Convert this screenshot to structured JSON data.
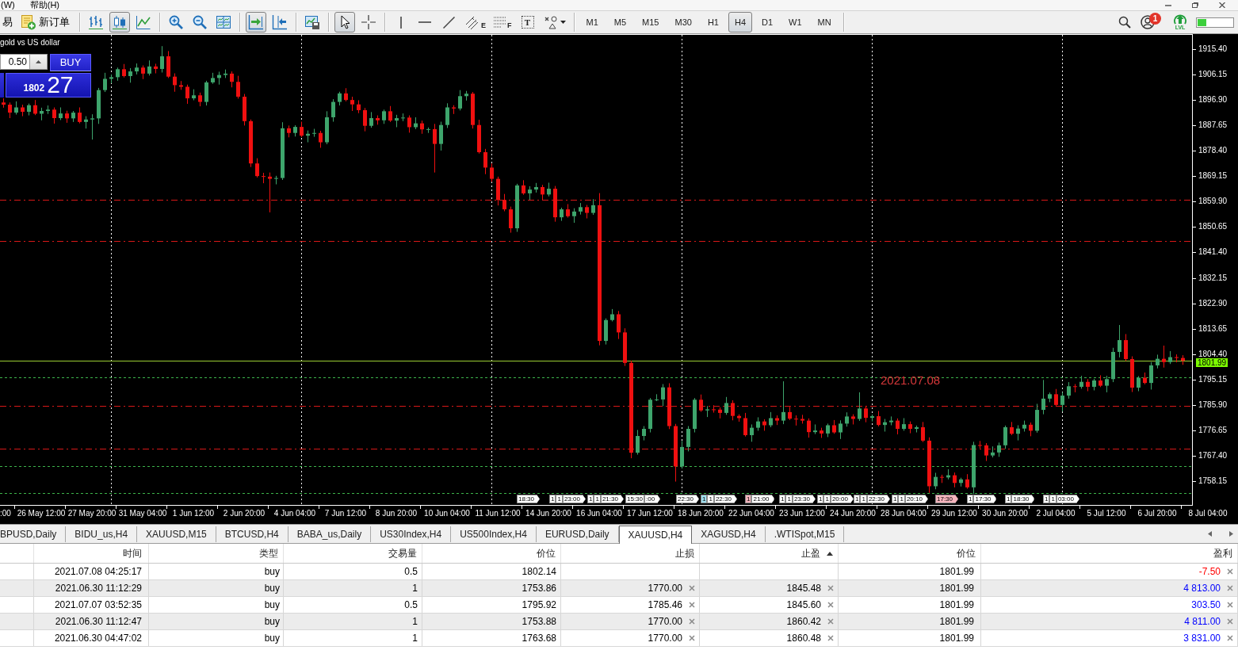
{
  "menu_bar": {
    "items": [
      {
        "label": "(W)"
      },
      {
        "label": "帮助(H)"
      }
    ]
  },
  "toolbar": {
    "trade_label": "易",
    "new_order_label": "新订单",
    "chart_types": [
      {
        "kind": "bars",
        "selected": false
      },
      {
        "kind": "candles",
        "selected": true
      },
      {
        "kind": "line",
        "selected": false
      }
    ],
    "auto_scroll": {
      "on": true
    },
    "chart_shift": {
      "on": false
    },
    "cursor_modes": [
      {
        "kind": "cursor",
        "selected": true
      },
      {
        "kind": "crosshair",
        "selected": false
      }
    ],
    "channel_letter": "E",
    "fibonacci_letter": "F",
    "text_tool_letter": "T",
    "timeframes": [
      {
        "label": "M1",
        "selected": false
      },
      {
        "label": "M5",
        "selected": false
      },
      {
        "label": "M15",
        "selected": false
      },
      {
        "label": "M30",
        "selected": false
      },
      {
        "label": "H1",
        "selected": false
      },
      {
        "label": "H4",
        "selected": true
      },
      {
        "label": "D1",
        "selected": false
      },
      {
        "label": "W1",
        "selected": false
      },
      {
        "label": "MN",
        "selected": false
      }
    ],
    "notification_count": "1",
    "level_label": "LVL",
    "meter": {
      "level": 0.25
    }
  },
  "chart": {
    "description": "gold vs US dollar",
    "one_click": {
      "lot": "0.50",
      "buy_label": "BUY",
      "buy_price_head": "1802",
      "buy_price_tail": "27"
    },
    "cut_time_label": ":00",
    "chart_data": {
      "type": "candlestick",
      "categories": [
        null,
        null,
        null,
        null,
        null,
        null,
        "26 May 12:00",
        null,
        null,
        null,
        null,
        null,
        null,
        null,
        "27 May 20:00",
        null,
        null,
        null,
        null,
        null,
        null,
        null,
        "31 May 04:00",
        null,
        null,
        null,
        null,
        null,
        null,
        null,
        "1 Jun 12:00",
        null,
        null,
        null,
        null,
        null,
        null,
        null,
        "2 Jun 20:00",
        null,
        null,
        null,
        null,
        null,
        null,
        null,
        "4 Jun 04:00",
        null,
        null,
        null,
        null,
        null,
        null,
        null,
        "7 Jun 12:00",
        null,
        null,
        null,
        null,
        null,
        null,
        null,
        "8 Jun 20:00",
        null,
        null,
        null,
        null,
        null,
        null,
        null,
        "10 Jun 04:00",
        null,
        null,
        null,
        null,
        null,
        null,
        null,
        "11 Jun 12:00",
        null,
        null,
        null,
        null,
        null,
        null,
        null,
        "14 Jun 20:00",
        null,
        null,
        null,
        null,
        null,
        null,
        null,
        "16 Jun 04:00",
        null,
        null,
        null,
        null,
        null,
        null,
        null,
        "17 Jun 12:00",
        null,
        null,
        null,
        null,
        null,
        null,
        null,
        "18 Jun 20:00",
        null,
        null,
        null,
        null,
        null,
        null,
        null,
        "22 Jun 04:00",
        null,
        null,
        null,
        null,
        null,
        null,
        null,
        "23 Jun 12:00",
        null,
        null,
        null,
        null,
        null,
        null,
        null,
        "24 Jun 20:00",
        null,
        null,
        null,
        null,
        null,
        null,
        null,
        "28 Jun 04:00",
        null,
        null,
        null,
        null,
        null,
        null,
        null,
        "29 Jun 12:00",
        null,
        null,
        null,
        null,
        null,
        null,
        null,
        "30 Jun 20:00",
        null,
        null,
        null,
        null,
        null,
        null,
        null,
        "2 Jul 04:00",
        null,
        null,
        null,
        null,
        null,
        null,
        null,
        "5 Jul 12:00",
        null,
        null,
        null,
        null,
        null,
        null,
        null,
        "6 Jul 20:00",
        null,
        null,
        null,
        null,
        null,
        null,
        null,
        "8 Jul 04:00"
      ],
      "ohlc": [
        [
          1896.0,
          1897.5,
          1894.1,
          1895.2
        ],
        [
          1895.2,
          1896.0,
          1890.3,
          1892.3
        ],
        [
          1892.3,
          1896.4,
          1891.6,
          1894.2
        ],
        [
          1894.2,
          1895.2,
          1891.0,
          1892.6
        ],
        [
          1892.6,
          1895.6,
          1891.3,
          1895.0
        ],
        [
          1895.0,
          1896.9,
          1891.4,
          1891.9
        ],
        [
          1891.9,
          1894.1,
          1889.5,
          1892.9
        ],
        [
          1892.9,
          1894.9,
          1891.8,
          1893.4
        ],
        [
          1893.4,
          1894.2,
          1888.3,
          1890.3
        ],
        [
          1890.3,
          1894.2,
          1889.6,
          1892.0
        ],
        [
          1892.0,
          1893.0,
          1888.6,
          1890.2
        ],
        [
          1890.2,
          1892.9,
          1888.9,
          1892.3
        ],
        [
          1892.3,
          1894.2,
          1888.4,
          1888.9
        ],
        [
          1888.9,
          1891.0,
          1886.5,
          1889.8
        ],
        [
          1889.8,
          1891.7,
          1882.5,
          1890.2
        ],
        [
          1890.2,
          1901.3,
          1888.2,
          1900.5
        ],
        [
          1900.5,
          1906.8,
          1899.8,
          1904.6
        ],
        [
          1904.6,
          1906.2,
          1903.0,
          1905.2
        ],
        [
          1905.2,
          1908.7,
          1903.9,
          1908.1
        ],
        [
          1908.1,
          1910.0,
          1905.1,
          1905.6
        ],
        [
          1905.6,
          1908.5,
          1903.2,
          1907.3
        ],
        [
          1907.3,
          1910.2,
          1906.2,
          1908.7
        ],
        [
          1908.7,
          1909.5,
          1904.5,
          1906.5
        ],
        [
          1906.5,
          1911.3,
          1905.8,
          1909.1
        ],
        [
          1909.1,
          1910.1,
          1906.6,
          1908.2
        ],
        [
          1908.2,
          1916.5,
          1906.9,
          1912.8
        ],
        [
          1912.8,
          1914.7,
          1904.9,
          1905.4
        ],
        [
          1905.4,
          1906.6,
          1899.9,
          1902.3
        ],
        [
          1902.3,
          1903.8,
          1900.6,
          1901.7
        ],
        [
          1901.7,
          1902.5,
          1895.5,
          1897.5
        ],
        [
          1897.5,
          1900.8,
          1896.8,
          1898.6
        ],
        [
          1898.6,
          1899.6,
          1894.6,
          1896.2
        ],
        [
          1896.2,
          1903.9,
          1894.9,
          1903.3
        ],
        [
          1903.3,
          1906.8,
          1902.8,
          1904.9
        ],
        [
          1904.9,
          1907.2,
          1902.5,
          1906.0
        ],
        [
          1906.0,
          1908.0,
          1904.9,
          1906.5
        ],
        [
          1906.5,
          1907.3,
          1901.5,
          1903.5
        ],
        [
          1903.5,
          1905.7,
          1897.4,
          1898.1
        ],
        [
          1898.1,
          1899.1,
          1887.6,
          1889.2
        ],
        [
          1889.2,
          1889.8,
          1872.5,
          1873.8
        ],
        [
          1873.8,
          1875.7,
          1868.7,
          1869.2
        ],
        [
          1869.2,
          1870.4,
          1866.6,
          1869.0
        ],
        [
          1869.0,
          1870.5,
          1856.0,
          1868.2
        ],
        [
          1868.2,
          1869.3,
          1866.2,
          1868.5
        ],
        [
          1868.5,
          1888.8,
          1867.8,
          1886.6
        ],
        [
          1886.6,
          1887.6,
          1883.3,
          1884.9
        ],
        [
          1884.9,
          1887.7,
          1883.6,
          1887.1
        ],
        [
          1887.1,
          1889.0,
          1883.4,
          1883.9
        ],
        [
          1883.9,
          1885.8,
          1881.5,
          1884.6
        ],
        [
          1884.6,
          1886.4,
          1883.5,
          1884.9
        ],
        [
          1884.9,
          1885.7,
          1879.5,
          1881.5
        ],
        [
          1881.5,
          1892.8,
          1880.8,
          1890.6
        ],
        [
          1890.6,
          1897.2,
          1889.0,
          1896.2
        ],
        [
          1896.2,
          1899.9,
          1894.9,
          1899.3
        ],
        [
          1899.3,
          1901.2,
          1896.4,
          1896.9
        ],
        [
          1896.9,
          1898.1,
          1892.9,
          1895.3
        ],
        [
          1895.3,
          1896.8,
          1892.1,
          1893.2
        ],
        [
          1893.2,
          1894.0,
          1885.5,
          1887.5
        ],
        [
          1887.5,
          1892.5,
          1886.8,
          1890.3
        ],
        [
          1890.3,
          1891.3,
          1887.9,
          1889.5
        ],
        [
          1889.5,
          1893.4,
          1888.2,
          1892.8
        ],
        [
          1892.8,
          1894.7,
          1888.9,
          1889.4
        ],
        [
          1889.4,
          1891.5,
          1887.0,
          1890.3
        ],
        [
          1890.3,
          1892.0,
          1889.2,
          1890.5
        ],
        [
          1890.5,
          1891.3,
          1885.0,
          1887.0
        ],
        [
          1887.0,
          1890.6,
          1886.3,
          1888.4
        ],
        [
          1888.4,
          1889.4,
          1884.6,
          1886.2
        ],
        [
          1886.2,
          1886.9,
          1884.9,
          1886.3
        ],
        [
          1886.3,
          1888.2,
          1870.5,
          1880.9
        ],
        [
          1880.9,
          1889.0,
          1878.5,
          1887.8
        ],
        [
          1887.8,
          1895.7,
          1886.7,
          1894.2
        ],
        [
          1894.2,
          1895.0,
          1891.8,
          1893.8
        ],
        [
          1893.8,
          1900.5,
          1893.1,
          1898.3
        ],
        [
          1898.3,
          1900.2,
          1896.7,
          1899.2
        ],
        [
          1899.2,
          1899.8,
          1886.5,
          1887.8
        ],
        [
          1887.8,
          1889.7,
          1877.4,
          1877.9
        ],
        [
          1877.9,
          1879.1,
          1869.9,
          1872.3
        ],
        [
          1872.3,
          1873.8,
          1867.1,
          1868.2
        ],
        [
          1868.2,
          1869.0,
          1858.5,
          1860.5
        ],
        [
          1860.5,
          1862.7,
          1856.4,
          1857.1
        ],
        [
          1857.1,
          1858.1,
          1848.6,
          1850.2
        ],
        [
          1850.2,
          1866.4,
          1848.9,
          1865.8
        ],
        [
          1865.8,
          1867.7,
          1862.4,
          1862.9
        ],
        [
          1862.9,
          1865.5,
          1860.5,
          1864.3
        ],
        [
          1864.3,
          1866.7,
          1863.2,
          1865.2
        ],
        [
          1865.2,
          1866.0,
          1860.5,
          1862.5
        ],
        [
          1862.5,
          1866.8,
          1861.8,
          1864.6
        ],
        [
          1864.6,
          1865.6,
          1852.6,
          1854.2
        ],
        [
          1854.2,
          1857.7,
          1852.9,
          1857.1
        ],
        [
          1857.1,
          1859.0,
          1854.1,
          1854.6
        ],
        [
          1854.6,
          1857.5,
          1852.2,
          1856.3
        ],
        [
          1856.3,
          1859.4,
          1855.2,
          1857.9
        ],
        [
          1857.9,
          1858.7,
          1853.8,
          1855.8
        ],
        [
          1855.8,
          1860.8,
          1855.1,
          1858.6
        ],
        [
          1858.6,
          1863.0,
          1807.6,
          1809.2
        ],
        [
          1809.2,
          1817.4,
          1807.9,
          1816.8
        ],
        [
          1816.8,
          1820.8,
          1816.3,
          1818.9
        ],
        [
          1818.9,
          1820.1,
          1809.9,
          1812.3
        ],
        [
          1812.3,
          1813.8,
          1800.1,
          1801.2
        ],
        [
          1801.2,
          1802.0,
          1766.5,
          1768.5
        ],
        [
          1768.5,
          1776.8,
          1767.8,
          1774.6
        ],
        [
          1774.6,
          1778.2,
          1773.0,
          1777.2
        ],
        [
          1777.2,
          1788.4,
          1775.9,
          1787.8
        ],
        [
          1787.8,
          1789.8,
          1787.3,
          1787.9
        ],
        [
          1787.9,
          1793.5,
          1785.5,
          1792.3
        ],
        [
          1792.3,
          1793.8,
          1777.1,
          1778.2
        ],
        [
          1778.2,
          1779.0,
          1758.0,
          1763.5
        ],
        [
          1763.5,
          1772.8,
          1762.8,
          1770.6
        ],
        [
          1770.6,
          1778.2,
          1769.0,
          1777.2
        ],
        [
          1777.2,
          1788.4,
          1775.9,
          1787.8
        ],
        [
          1787.8,
          1789.7,
          1783.4,
          1783.9
        ],
        [
          1783.9,
          1785.5,
          1781.5,
          1784.3
        ],
        [
          1784.3,
          1785.8,
          1783.1,
          1784.2
        ],
        [
          1784.2,
          1785.0,
          1781.0,
          1783.0
        ],
        [
          1783.0,
          1788.8,
          1782.3,
          1786.6
        ],
        [
          1786.6,
          1787.6,
          1780.3,
          1781.9
        ],
        [
          1781.9,
          1782.5,
          1779.8,
          1781.1
        ],
        [
          1781.1,
          1783.0,
          1774.4,
          1774.9
        ],
        [
          1774.9,
          1778.8,
          1772.5,
          1777.6
        ],
        [
          1777.6,
          1781.4,
          1776.5,
          1779.9
        ],
        [
          1779.9,
          1780.7,
          1776.5,
          1778.5
        ],
        [
          1778.5,
          1783.3,
          1777.8,
          1781.1
        ],
        [
          1781.1,
          1782.1,
          1778.6,
          1780.2
        ],
        [
          1780.2,
          1794.5,
          1778.9,
          1783.3
        ],
        [
          1783.3,
          1785.2,
          1780.4,
          1780.9
        ],
        [
          1780.9,
          1782.1,
          1778.4,
          1780.8
        ],
        [
          1780.8,
          1782.3,
          1779.1,
          1780.2
        ],
        [
          1780.2,
          1781.0,
          1774.0,
          1776.0
        ],
        [
          1776.0,
          1778.8,
          1775.3,
          1776.6
        ],
        [
          1776.6,
          1777.6,
          1773.9,
          1775.5
        ],
        [
          1775.5,
          1779.1,
          1774.2,
          1778.5
        ],
        [
          1778.5,
          1780.4,
          1775.4,
          1775.9
        ],
        [
          1775.9,
          1780.3,
          1773.5,
          1779.1
        ],
        [
          1779.1,
          1783.2,
          1778.0,
          1781.7
        ],
        [
          1781.7,
          1782.5,
          1778.8,
          1780.8
        ],
        [
          1780.8,
          1790.5,
          1780.1,
          1784.6
        ],
        [
          1784.6,
          1785.6,
          1779.6,
          1781.2
        ],
        [
          1781.2,
          1782.4,
          1779.9,
          1781.8
        ],
        [
          1781.8,
          1783.7,
          1778.1,
          1778.6
        ],
        [
          1778.6,
          1780.8,
          1776.2,
          1779.6
        ],
        [
          1779.6,
          1781.7,
          1778.5,
          1780.2
        ],
        [
          1780.2,
          1781.0,
          1775.2,
          1777.2
        ],
        [
          1777.2,
          1781.1,
          1776.5,
          1778.9
        ],
        [
          1778.9,
          1779.9,
          1775.6,
          1777.2
        ],
        [
          1777.2,
          1778.4,
          1775.9,
          1777.8
        ],
        [
          1777.8,
          1779.7,
          1772.4,
          1772.9
        ],
        [
          1772.9,
          1774.1,
          1753.9,
          1756.3
        ],
        [
          1756.3,
          1761.2,
          1755.2,
          1759.7
        ],
        [
          1759.7,
          1760.5,
          1757.5,
          1759.5
        ],
        [
          1759.5,
          1762.5,
          1758.8,
          1760.3
        ],
        [
          1760.3,
          1761.3,
          1755.9,
          1757.5
        ],
        [
          1757.5,
          1759.4,
          1756.2,
          1758.8
        ],
        [
          1758.8,
          1760.7,
          1755.4,
          1755.9
        ],
        [
          1755.9,
          1772.5,
          1753.5,
          1771.3
        ],
        [
          1771.3,
          1772.8,
          1770.1,
          1771.2
        ],
        [
          1771.2,
          1772.0,
          1765.5,
          1767.5
        ],
        [
          1767.5,
          1770.8,
          1766.8,
          1768.6
        ],
        [
          1768.6,
          1772.2,
          1767.0,
          1771.2
        ],
        [
          1771.2,
          1778.4,
          1769.9,
          1777.8
        ],
        [
          1777.8,
          1779.7,
          1774.9,
          1775.4
        ],
        [
          1775.4,
          1778.5,
          1773.0,
          1777.3
        ],
        [
          1777.3,
          1780.2,
          1776.2,
          1778.7
        ],
        [
          1778.7,
          1779.5,
          1774.5,
          1776.5
        ],
        [
          1776.5,
          1786.3,
          1775.8,
          1784.1
        ],
        [
          1784.1,
          1795.0,
          1782.5,
          1788.2
        ],
        [
          1788.2,
          1790.4,
          1786.9,
          1789.8
        ],
        [
          1789.8,
          1791.7,
          1785.4,
          1785.9
        ],
        [
          1785.9,
          1790.5,
          1783.5,
          1789.3
        ],
        [
          1789.3,
          1794.2,
          1788.2,
          1792.7
        ],
        [
          1792.7,
          1793.5,
          1790.5,
          1792.5
        ],
        [
          1792.5,
          1796.5,
          1791.8,
          1794.3
        ],
        [
          1794.3,
          1795.3,
          1790.9,
          1792.5
        ],
        [
          1792.5,
          1795.4,
          1791.2,
          1794.8
        ],
        [
          1794.8,
          1796.7,
          1792.4,
          1792.9
        ],
        [
          1792.9,
          1796.5,
          1790.5,
          1795.3
        ],
        [
          1795.3,
          1806.7,
          1794.2,
          1805.2
        ],
        [
          1805.2,
          1815.0,
          1803.2,
          1809.5
        ],
        [
          1809.5,
          1811.7,
          1801.9,
          1802.6
        ],
        [
          1802.6,
          1803.6,
          1790.6,
          1792.2
        ],
        [
          1792.2,
          1796.4,
          1790.9,
          1795.8
        ],
        [
          1795.8,
          1797.7,
          1793.4,
          1793.9
        ],
        [
          1793.9,
          1801.5,
          1791.5,
          1800.3
        ],
        [
          1800.3,
          1804.2,
          1799.2,
          1802.7
        ],
        [
          1802.7,
          1807.5,
          1799.5,
          1801.5
        ],
        [
          1801.5,
          1805.5,
          1800.8,
          1803.3
        ],
        [
          1803.3,
          1804.3,
          1801.4,
          1803.0
        ],
        [
          1803.0,
          1804.0,
          1800.5,
          1801.99
        ],
        null,
        null,
        null,
        null
      ],
      "ylim": [
        1749.5,
        1920.6
      ],
      "yticks": [
        {
          "value": 1915.4,
          "label": "1915.40"
        },
        {
          "value": 1906.15,
          "label": "1906.15"
        },
        {
          "value": 1896.9,
          "label": "1896.90"
        },
        {
          "value": 1887.65,
          "label": "1887.65"
        },
        {
          "value": 1878.4,
          "label": "1878.40"
        },
        {
          "value": 1869.15,
          "label": "1869.15"
        },
        {
          "value": 1859.9,
          "label": "1859.90"
        },
        {
          "value": 1850.65,
          "label": "1850.65"
        },
        {
          "value": 1841.4,
          "label": "1841.40"
        },
        {
          "value": 1832.15,
          "label": "1832.15"
        },
        {
          "value": 1822.9,
          "label": "1822.90"
        },
        {
          "value": 1813.65,
          "label": "1813.65"
        },
        {
          "value": 1804.4,
          "label": "1804.40"
        },
        {
          "value": 1795.15,
          "label": "1795.15"
        },
        {
          "value": 1785.9,
          "label": "1785.90"
        },
        {
          "value": 1776.65,
          "label": "1776.65"
        },
        {
          "value": 1767.4,
          "label": "1767.40"
        },
        {
          "value": 1758.15,
          "label": "1758.15"
        }
      ],
      "ref_lines": [
        {
          "axis": "y",
          "value": 1860.45,
          "color": "#d81818"
        },
        {
          "axis": "y",
          "value": 1845.54,
          "color": "#d81818"
        },
        {
          "axis": "y",
          "value": 1785.46,
          "color": "#d81818"
        },
        {
          "axis": "y",
          "value": 1770.0,
          "color": "#d81818"
        },
        {
          "axis": "y",
          "value": 1795.92,
          "color": "#3cb44b"
        },
        {
          "axis": "y",
          "value": 1763.68,
          "color": "#3cb44b"
        },
        {
          "axis": "y",
          "value": 1753.87,
          "color": "#3cb44b"
        },
        {
          "axis": "y",
          "value": 1801.99,
          "color": "#9acd32",
          "label": "1801.99"
        }
      ],
      "annotations": [
        "2021.07.08"
      ]
    },
    "markers": [
      {
        "parts": [
          {
            "text": "18:30",
            "color": "#ffffff"
          }
        ]
      },
      {
        "parts": [
          {
            "text": "1",
            "color": "#ffffff"
          },
          {
            "text": "1",
            "color": "#ffffff"
          },
          {
            "text": "23:00",
            "color": "#ffffff"
          }
        ]
      },
      {
        "parts": [
          {
            "text": "1",
            "color": "#ffffff"
          },
          {
            "text": "1",
            "color": "#ffffff"
          },
          {
            "text": "21:30",
            "color": "#ffffff"
          }
        ]
      },
      {
        "parts": [
          {
            "text": "15:30",
            "color": "#ffffff"
          },
          {
            "text": ":00",
            "color": "#ffffff"
          }
        ]
      },
      {
        "parts": [
          {
            "text": "22:30",
            "color": "#ffffff"
          }
        ]
      },
      {
        "parts": [
          {
            "text": "1",
            "color": "#9fe0f0"
          },
          {
            "text": "1",
            "color": "#ffffff"
          },
          {
            "text": "22:30",
            "color": "#ffffff"
          }
        ]
      },
      {
        "parts": [
          {
            "text": "1",
            "color": "#f6b4bd"
          },
          {
            "text": "21:00",
            "color": "#ffffff"
          }
        ]
      },
      {
        "parts": [
          {
            "text": "1",
            "color": "#ffffff"
          },
          {
            "text": "1",
            "color": "#ffffff"
          },
          {
            "text": "23:30",
            "color": "#ffffff"
          }
        ]
      },
      {
        "parts": [
          {
            "text": "1",
            "color": "#ffffff"
          },
          {
            "text": "1",
            "color": "#ffffff"
          },
          {
            "text": "20:00",
            "color": "#ffffff"
          }
        ]
      },
      {
        "parts": [
          {
            "text": "1",
            "color": "#ffffff"
          },
          {
            "text": "1",
            "color": "#ffffff"
          },
          {
            "text": "22:30",
            "color": "#ffffff"
          }
        ]
      },
      {
        "parts": [
          {
            "text": "1",
            "color": "#ffffff"
          },
          {
            "text": "1",
            "color": "#ffffff"
          },
          {
            "text": "20:10",
            "color": "#ffffff"
          }
        ]
      },
      {
        "parts": [
          {
            "text": "17:30",
            "color": "#f6b4bd"
          }
        ]
      },
      {
        "parts": [
          {
            "text": "1",
            "color": "#ffffff"
          },
          {
            "text": "17:30",
            "color": "#ffffff"
          }
        ]
      },
      {
        "parts": [
          {
            "text": "1",
            "color": "#ffffff"
          },
          {
            "text": "18:30",
            "color": "#ffffff"
          }
        ]
      },
      {
        "parts": [
          {
            "text": "1",
            "color": "#ffffff"
          },
          {
            "text": "1",
            "color": "#ffffff"
          },
          {
            "text": "03:00",
            "color": "#ffffff"
          }
        ]
      }
    ]
  },
  "symbol_tabs": [
    {
      "label": "BPUSD,Daily",
      "selected": false
    },
    {
      "label": "BIDU_us,H4",
      "selected": false
    },
    {
      "label": "XAUUSD,M15",
      "selected": false
    },
    {
      "label": "BTCUSD,H4",
      "selected": false
    },
    {
      "label": "BABA_us,Daily",
      "selected": false
    },
    {
      "label": "US30Index,H4",
      "selected": false
    },
    {
      "label": "US500Index,H4",
      "selected": false
    },
    {
      "label": "EURUSD,Daily",
      "selected": false
    },
    {
      "label": "XAUUSD,H4",
      "selected": true
    },
    {
      "label": "XAGUSD,H4",
      "selected": false
    },
    {
      "label": ".WTISpot,M15",
      "selected": false
    }
  ],
  "trades_table": {
    "columns": [
      {
        "label": "时间"
      },
      {
        "label": "类型"
      },
      {
        "label": "交易量"
      },
      {
        "label": "价位"
      },
      {
        "label": "止损"
      },
      {
        "label": "止盈",
        "sorted": true
      },
      {
        "label": "价位"
      },
      {
        "label": "盈利"
      }
    ],
    "rows": [
      {
        "time": "2021.07.08 04:25:17",
        "type": "buy",
        "volume": "0.5",
        "price": "1802.14",
        "current_price": "1801.99",
        "profit": {
          "text": "-7.50",
          "color": "#ff0000"
        }
      },
      {
        "time": "2021.06.30 11:12:29",
        "type": "buy",
        "volume": "1",
        "price": "1753.86",
        "stop_loss": "1770.00",
        "take_profit": "1845.48",
        "current_price": "1801.99",
        "profit": {
          "text": "4 813.00",
          "color": "#0000ff"
        }
      },
      {
        "time": "2021.07.07 03:52:35",
        "type": "buy",
        "volume": "0.5",
        "price": "1795.92",
        "stop_loss": "1785.46",
        "take_profit": "1845.60",
        "current_price": "1801.99",
        "profit": {
          "text": "303.50",
          "color": "#0000ff"
        }
      },
      {
        "time": "2021.06.30 11:12:47",
        "type": "buy",
        "volume": "1",
        "price": "1753.88",
        "stop_loss": "1770.00",
        "take_profit": "1860.42",
        "current_price": "1801.99",
        "profit": {
          "text": "4 811.00",
          "color": "#0000ff"
        }
      },
      {
        "time": "2021.06.30 04:47:02",
        "type": "buy",
        "volume": "1",
        "price": "1763.68",
        "stop_loss": "1770.00",
        "take_profit": "1860.48",
        "current_price": "1801.99",
        "profit": {
          "text": "3 831.00",
          "color": "#0000ff"
        }
      }
    ]
  }
}
